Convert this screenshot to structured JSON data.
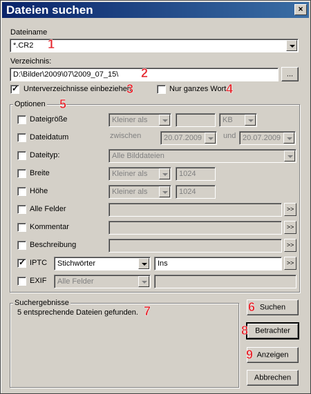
{
  "window": {
    "title": "Dateien suchen",
    "close_glyph": "×"
  },
  "search": {
    "filename_label": "Dateiname",
    "filename_value": "*.CR2",
    "folder_label": "Verzeichnis:",
    "folder_value": "D:\\Bilder\\2009\\07\\2009_07_15\\",
    "browse_label": "...",
    "subfolders_label": "Unterverzeichnisse einbeziehen",
    "subfolders_checked": true,
    "whole_word_label": "Nur ganzes Wort",
    "whole_word_checked": false
  },
  "options": {
    "legend": "Optionen",
    "filesize": {
      "label": "Dateigröße",
      "op": "Kleiner als",
      "value": "",
      "unit": "KB"
    },
    "filedate": {
      "label": "Dateidatum",
      "between": "zwischen",
      "from": "20.07.2009",
      "and": "und",
      "to": "20.07.2009"
    },
    "filetype": {
      "label": "Dateityp:",
      "value": "Alle Bilddateien"
    },
    "width": {
      "label": "Breite",
      "op": "Kleiner als",
      "value": "1024"
    },
    "height": {
      "label": "Höhe",
      "op": "Kleiner als",
      "value": "1024"
    },
    "allfields": {
      "label": "Alle Felder"
    },
    "comment": {
      "label": "Kommentar"
    },
    "description": {
      "label": "Beschreibung"
    },
    "iptc": {
      "label": "IPTC",
      "field": "Stichwörter",
      "value": "Ins",
      "checked": true
    },
    "exif": {
      "label": "EXIF",
      "field": "Alle Felder",
      "value": ""
    },
    "more_label": ">>"
  },
  "results": {
    "legend": "Suchergebnisse",
    "text": "5 entsprechende Dateien gefunden."
  },
  "buttons": {
    "search": "Suchen",
    "viewer": "Betrachter",
    "show": "Anzeigen",
    "cancel": "Abbrechen"
  },
  "callouts": [
    "1",
    "2",
    "3",
    "4",
    "5",
    "6",
    "7",
    "8",
    "9"
  ],
  "colors": {
    "titlebar": "#0a246a",
    "callout": "#e5242b",
    "face": "#d4d0c8"
  }
}
